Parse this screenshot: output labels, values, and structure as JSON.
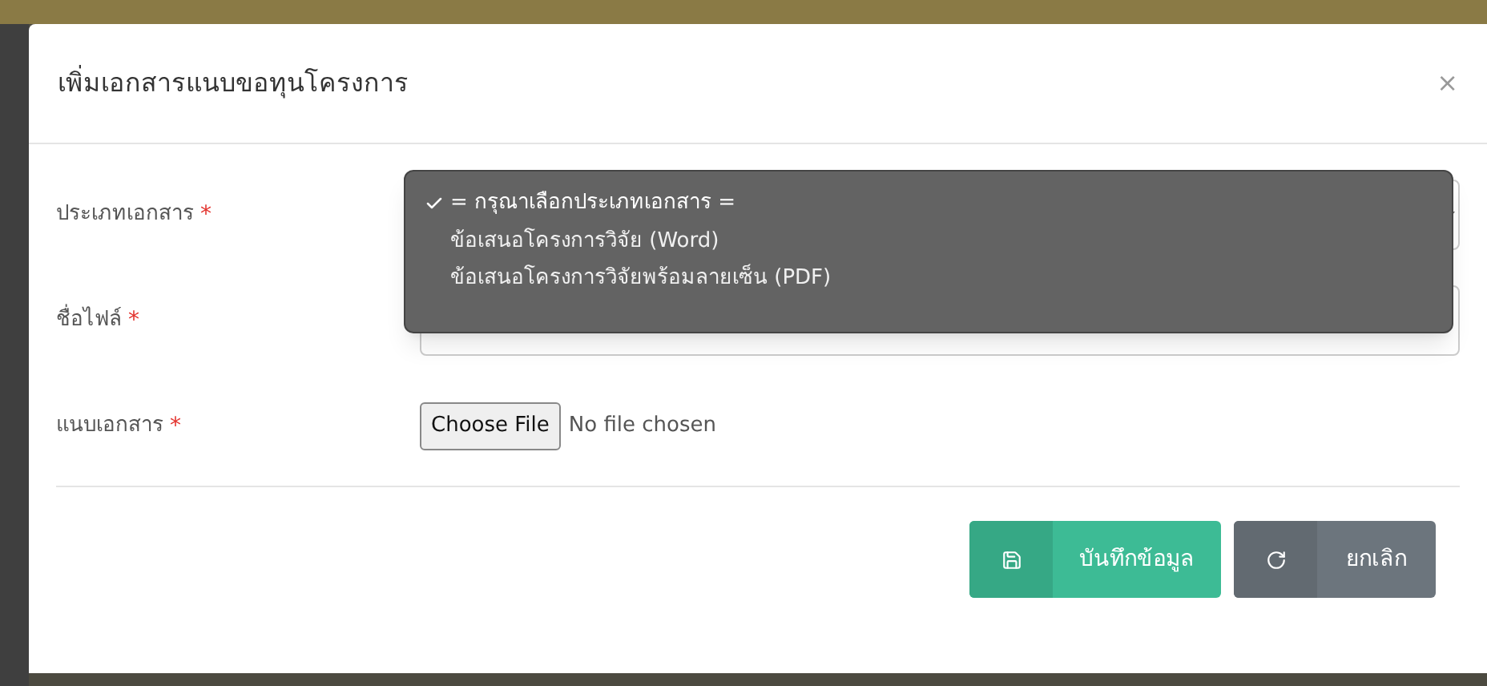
{
  "dialog": {
    "title": "เพิ่มเอกสารแนบขอทุนโครงการ",
    "close": "×"
  },
  "fields": [
    {
      "kind": "select",
      "label": "ประเภทเอกสาร",
      "required_mark": "*",
      "options": [
        {
          "label": "= กรุณาเลือกประเภทเอกสาร =",
          "selected": true
        },
        {
          "label": "ข้อเสนอโครงการวิจัย (Word)",
          "selected": false
        },
        {
          "label": "ข้อเสนอโครงการวิจัยพร้อมลายเซ็น (PDF)",
          "selected": false
        }
      ]
    },
    {
      "kind": "text",
      "label": "ชื่อไฟล์",
      "required_mark": "*"
    },
    {
      "kind": "file",
      "label": "แนบเอกสาร",
      "required_mark": "*",
      "button": "Choose File",
      "status": "No file chosen"
    }
  ],
  "buttons": [
    {
      "kind": "save",
      "label": "บันทึกข้อมูล"
    },
    {
      "kind": "cancel",
      "label": "ยกเลิก"
    }
  ]
}
